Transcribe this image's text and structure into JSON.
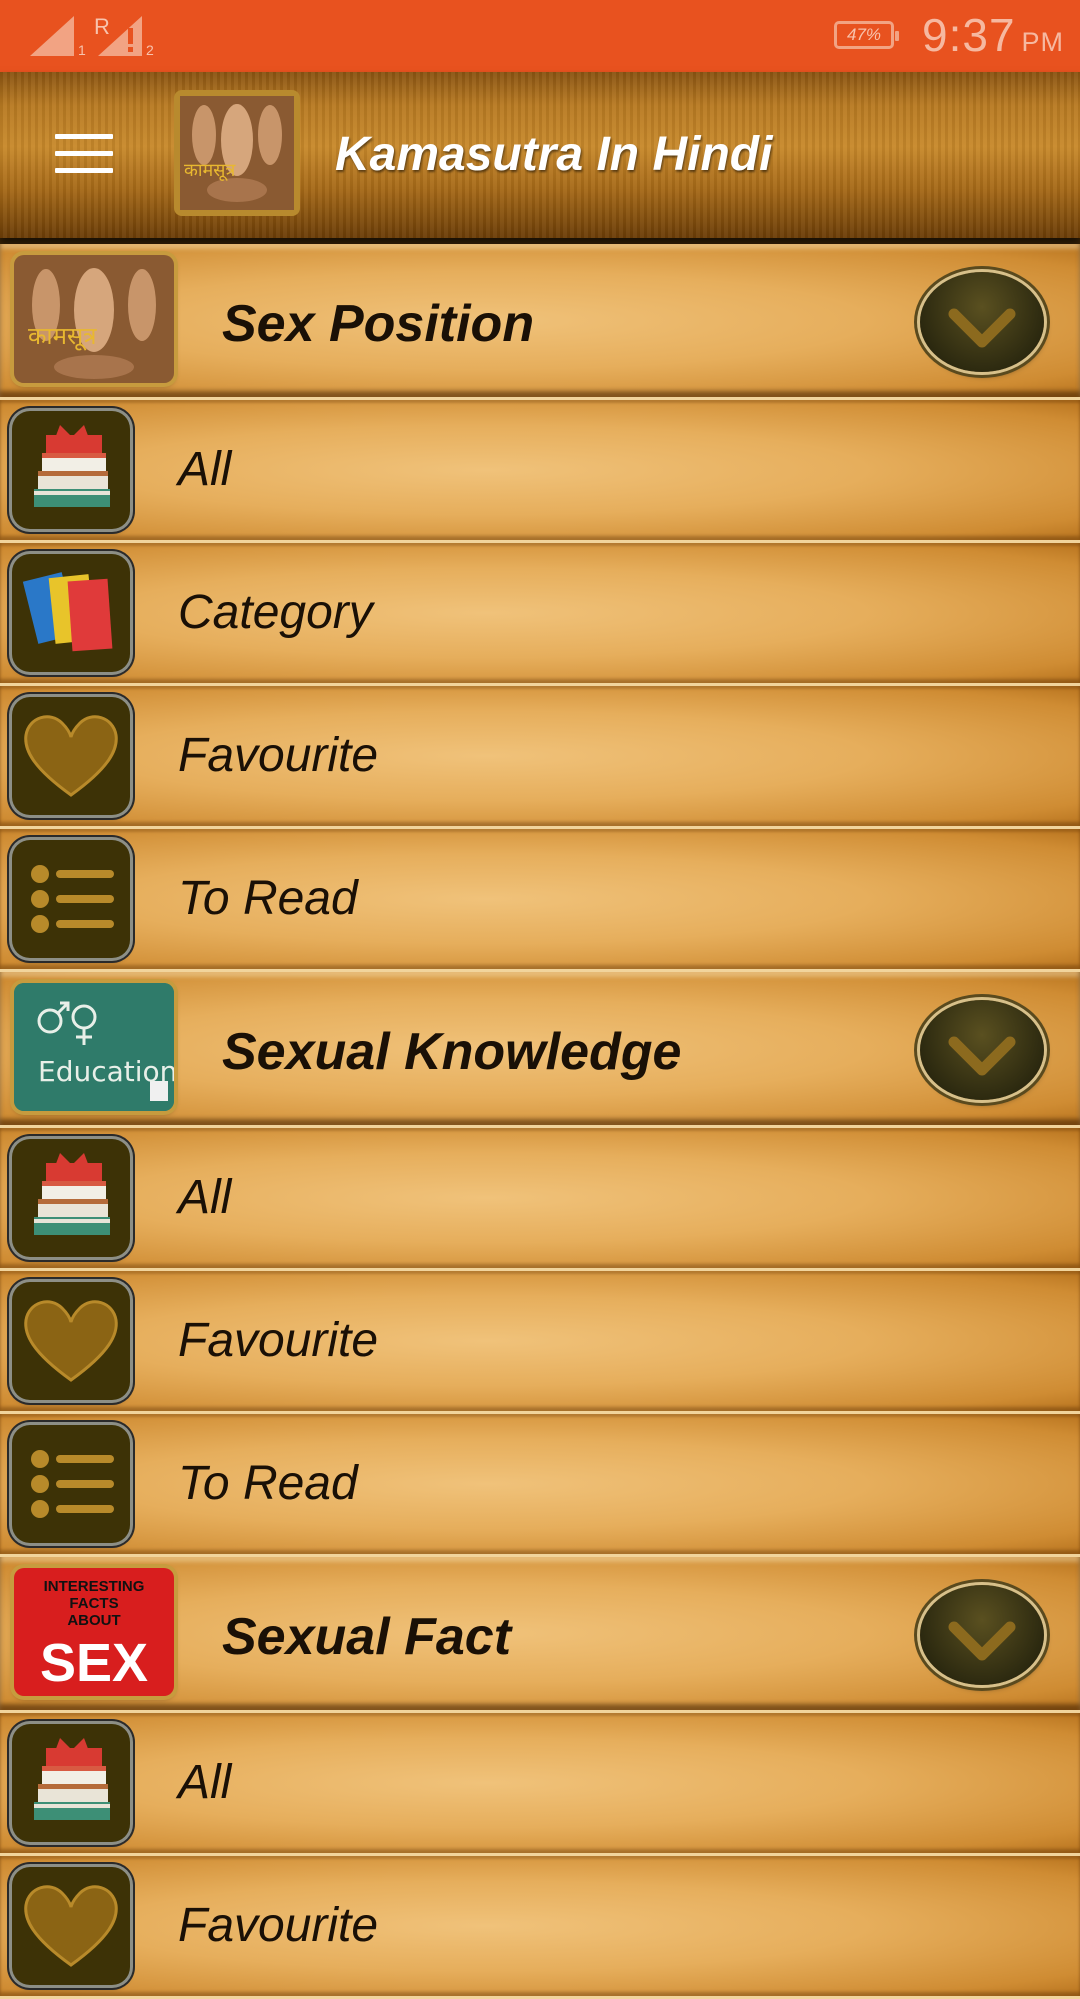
{
  "status_bar": {
    "sim1_label": "1",
    "sim2_label": "2",
    "roaming_label": "R",
    "battery_percent": "47%",
    "time": "9:37",
    "am_pm": "PM",
    "background_color": "#e8521f"
  },
  "toolbar": {
    "menu_icon": "hamburger-menu-icon",
    "logo_text": "कामसूत्र",
    "title": "Kamasutra In Hindi"
  },
  "sections": [
    {
      "title": "Sex Position",
      "image": "kamasutra-sculpture-image",
      "image_text": "कामसूत्र",
      "items": [
        {
          "label": "All",
          "icon": "books-icon"
        },
        {
          "label": "Category",
          "icon": "category-books-icon"
        },
        {
          "label": "Favourite",
          "icon": "heart-icon"
        },
        {
          "label": "To Read",
          "icon": "list-icon"
        }
      ]
    },
    {
      "title": "Sexual Knowledge",
      "image": "education-chalkboard-image",
      "image_text": "Education",
      "items": [
        {
          "label": "All",
          "icon": "books-icon"
        },
        {
          "label": "Favourite",
          "icon": "heart-icon"
        },
        {
          "label": "To Read",
          "icon": "list-icon"
        }
      ]
    },
    {
      "title": "Sexual Fact",
      "image": "interesting-facts-image",
      "image_text_1": "INTERESTING",
      "image_text_2": "FACTS",
      "image_text_3": "ABOUT",
      "image_text_4": "SEX",
      "items": [
        {
          "label": "All",
          "icon": "books-icon"
        },
        {
          "label": "Favourite",
          "icon": "heart-icon"
        }
      ]
    }
  ],
  "colors": {
    "accent_gold": "#c8892b",
    "icon_bg": "#3d3206",
    "heart": "#8b6414"
  }
}
